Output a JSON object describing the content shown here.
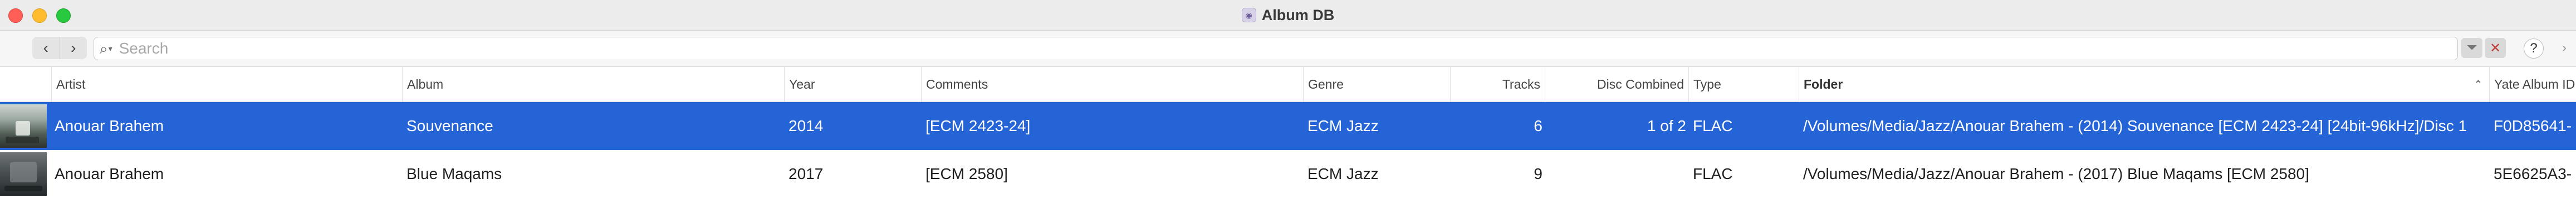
{
  "window": {
    "title": "Album DB",
    "app_icon": "album-db-app-icon",
    "traffic_lights": {
      "close_color": "#ff5f57",
      "minimize_color": "#febc2e",
      "maximize_color": "#28c840"
    }
  },
  "toolbar": {
    "back_glyph": "‹",
    "forward_glyph": "›",
    "search": {
      "placeholder": "Search",
      "value": ""
    },
    "help_label": "?",
    "more_glyph": "›"
  },
  "table": {
    "columns": {
      "artist": "Artist",
      "album": "Album",
      "year": "Year",
      "comments": "Comments",
      "genre": "Genre",
      "tracks": "Tracks",
      "disc_combined": "Disc Combined",
      "type": "Type",
      "folder": "Folder",
      "yate_album_id": "Yate Album ID"
    },
    "sorted_column": "folder",
    "selection_color": "#2464d6",
    "rows": [
      {
        "artist": "Anouar Brahem",
        "album": "Souvenance",
        "year": "2014",
        "comments": "[ECM 2423-24]",
        "genre": "ECM Jazz",
        "tracks": "6",
        "disc_combined": "1 of 2",
        "type": "FLAC",
        "folder": "/Volumes/Media/Jazz/Anouar Brahem - (2014) Souvenance [ECM 2423-24] [24bit-96kHz]/Disc 1",
        "yate_album_id": "F0D85641-",
        "selected": true
      },
      {
        "artist": "Anouar Brahem",
        "album": "Blue Maqams",
        "year": "2017",
        "comments": "[ECM 2580]",
        "genre": "ECM Jazz",
        "tracks": "9",
        "disc_combined": "",
        "type": "FLAC",
        "folder": "/Volumes/Media/Jazz/Anouar Brahem - (2017) Blue Maqams [ECM 2580]",
        "yate_album_id": "5E6625A3-",
        "selected": false
      }
    ]
  }
}
